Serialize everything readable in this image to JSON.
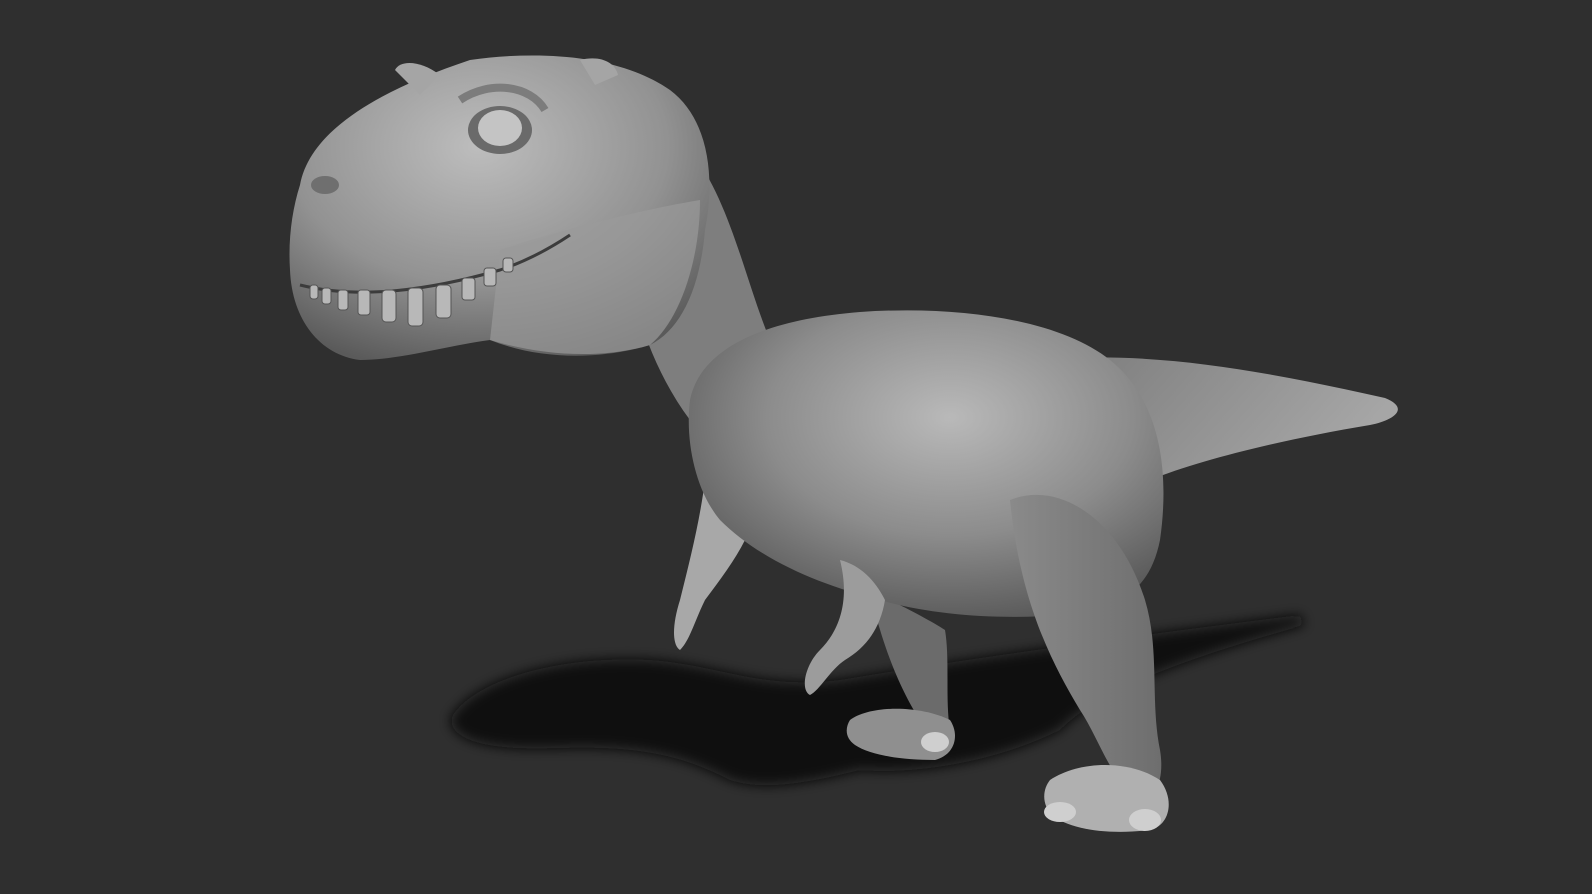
{
  "scene": {
    "subject": "t-rex-sculpt",
    "colors": {
      "background": "#2f2f2f",
      "clay_light": "#b4b4b4",
      "clay_mid": "#8a8a8a",
      "clay_dark": "#4a4a4a",
      "shadow": "#0d0d0d"
    }
  }
}
